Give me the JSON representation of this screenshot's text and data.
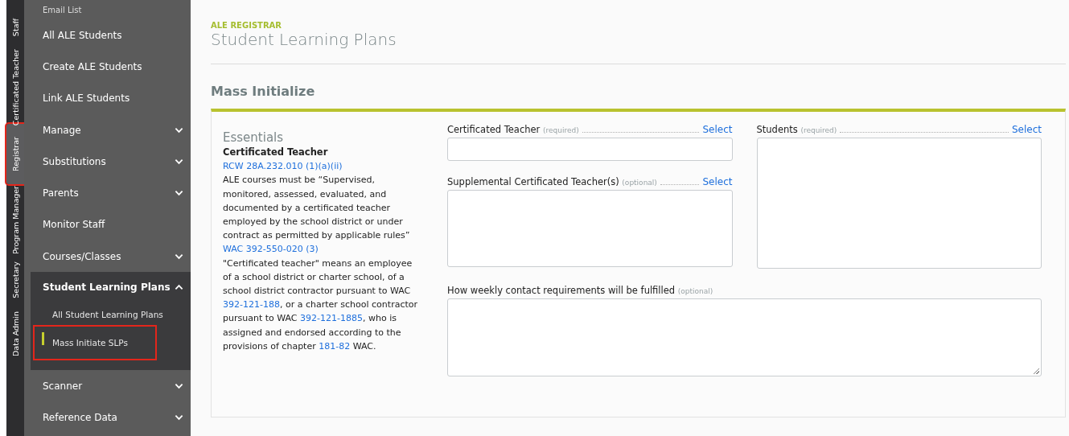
{
  "role_tabs": [
    {
      "label": "Staff",
      "selected": false,
      "highlighted": false
    },
    {
      "label": "Certificated Teacher",
      "selected": false,
      "highlighted": false
    },
    {
      "label": "Registrar",
      "selected": true,
      "highlighted": true
    },
    {
      "label": "Program Manager",
      "selected": false,
      "highlighted": false
    },
    {
      "label": "Secretary",
      "selected": false,
      "highlighted": false
    },
    {
      "label": "Data Admin",
      "selected": false,
      "highlighted": false
    }
  ],
  "sidebar": {
    "items": [
      {
        "label": "Email List",
        "expandable": false,
        "expanded": false
      },
      {
        "label": "All ALE Students",
        "expandable": false,
        "expanded": false
      },
      {
        "label": "Create ALE Students",
        "expandable": false,
        "expanded": false
      },
      {
        "label": "Link ALE Students",
        "expandable": false,
        "expanded": false
      },
      {
        "label": "Manage",
        "expandable": true,
        "expanded": false
      },
      {
        "label": "Substitutions",
        "expandable": true,
        "expanded": false
      },
      {
        "label": "Parents",
        "expandable": true,
        "expanded": false
      },
      {
        "label": "Monitor Staff",
        "expandable": false,
        "expanded": false
      },
      {
        "label": "Courses/Classes",
        "expandable": true,
        "expanded": false
      },
      {
        "label": "Student Learning Plans",
        "expandable": true,
        "expanded": true,
        "children": [
          {
            "label": "All Student Learning Plans",
            "selected": false,
            "highlighted": false
          },
          {
            "label": "Mass Initiate SLPs",
            "selected": true,
            "highlighted": true
          }
        ]
      },
      {
        "label": "Scanner",
        "expandable": true,
        "expanded": false
      },
      {
        "label": "Reference Data",
        "expandable": true,
        "expanded": false
      }
    ]
  },
  "header": {
    "eyebrow": "ALE REGISTRAR",
    "title": "Student Learning Plans"
  },
  "section_title": "Mass Initialize",
  "essentials": {
    "title": "Essentials",
    "subtitle": "Certificated Teacher",
    "blocks": [
      {
        "kind": "link",
        "text": "RCW 28A.232.010 (1)(a)(ii)"
      },
      {
        "kind": "paragraph",
        "parts": [
          {
            "text": "ALE courses must be “Supervised, monitored, assessed, evaluated, and documented by a certificated teacher employed by the school district or under contract as permitted by applicable rules”",
            "kind": "text"
          }
        ]
      },
      {
        "kind": "link",
        "text": "WAC 392-550-020 (3)"
      },
      {
        "kind": "paragraph",
        "parts": [
          {
            "text": "\"Certificated teacher\" means an employee of a school district or charter school, of a school district contractor pursuant to WAC ",
            "kind": "text"
          },
          {
            "text": "392-121-188",
            "kind": "link"
          },
          {
            "text": ", or a charter school contractor pursuant to WAC ",
            "kind": "text"
          },
          {
            "text": "392-121-1885",
            "kind": "link"
          },
          {
            "text": ", who is assigned and endorsed according to the provisions of chapter ",
            "kind": "text"
          },
          {
            "text": "181-82",
            "kind": "link"
          },
          {
            "text": " WAC.",
            "kind": "text"
          }
        ]
      }
    ]
  },
  "fields": [
    {
      "label": "Certificated Teacher",
      "note": "(required)",
      "action": "Select",
      "kind": "single"
    },
    {
      "label": "Students",
      "note": "(required)",
      "action": "Select",
      "kind": "tall"
    },
    {
      "label": "Supplemental Certificated Teacher(s)",
      "note": "(optional)",
      "action": "Select",
      "kind": "list"
    },
    {
      "label": "How weekly contact requirements will be fulfilled",
      "note": "(optional)",
      "kind": "textarea"
    }
  ]
}
